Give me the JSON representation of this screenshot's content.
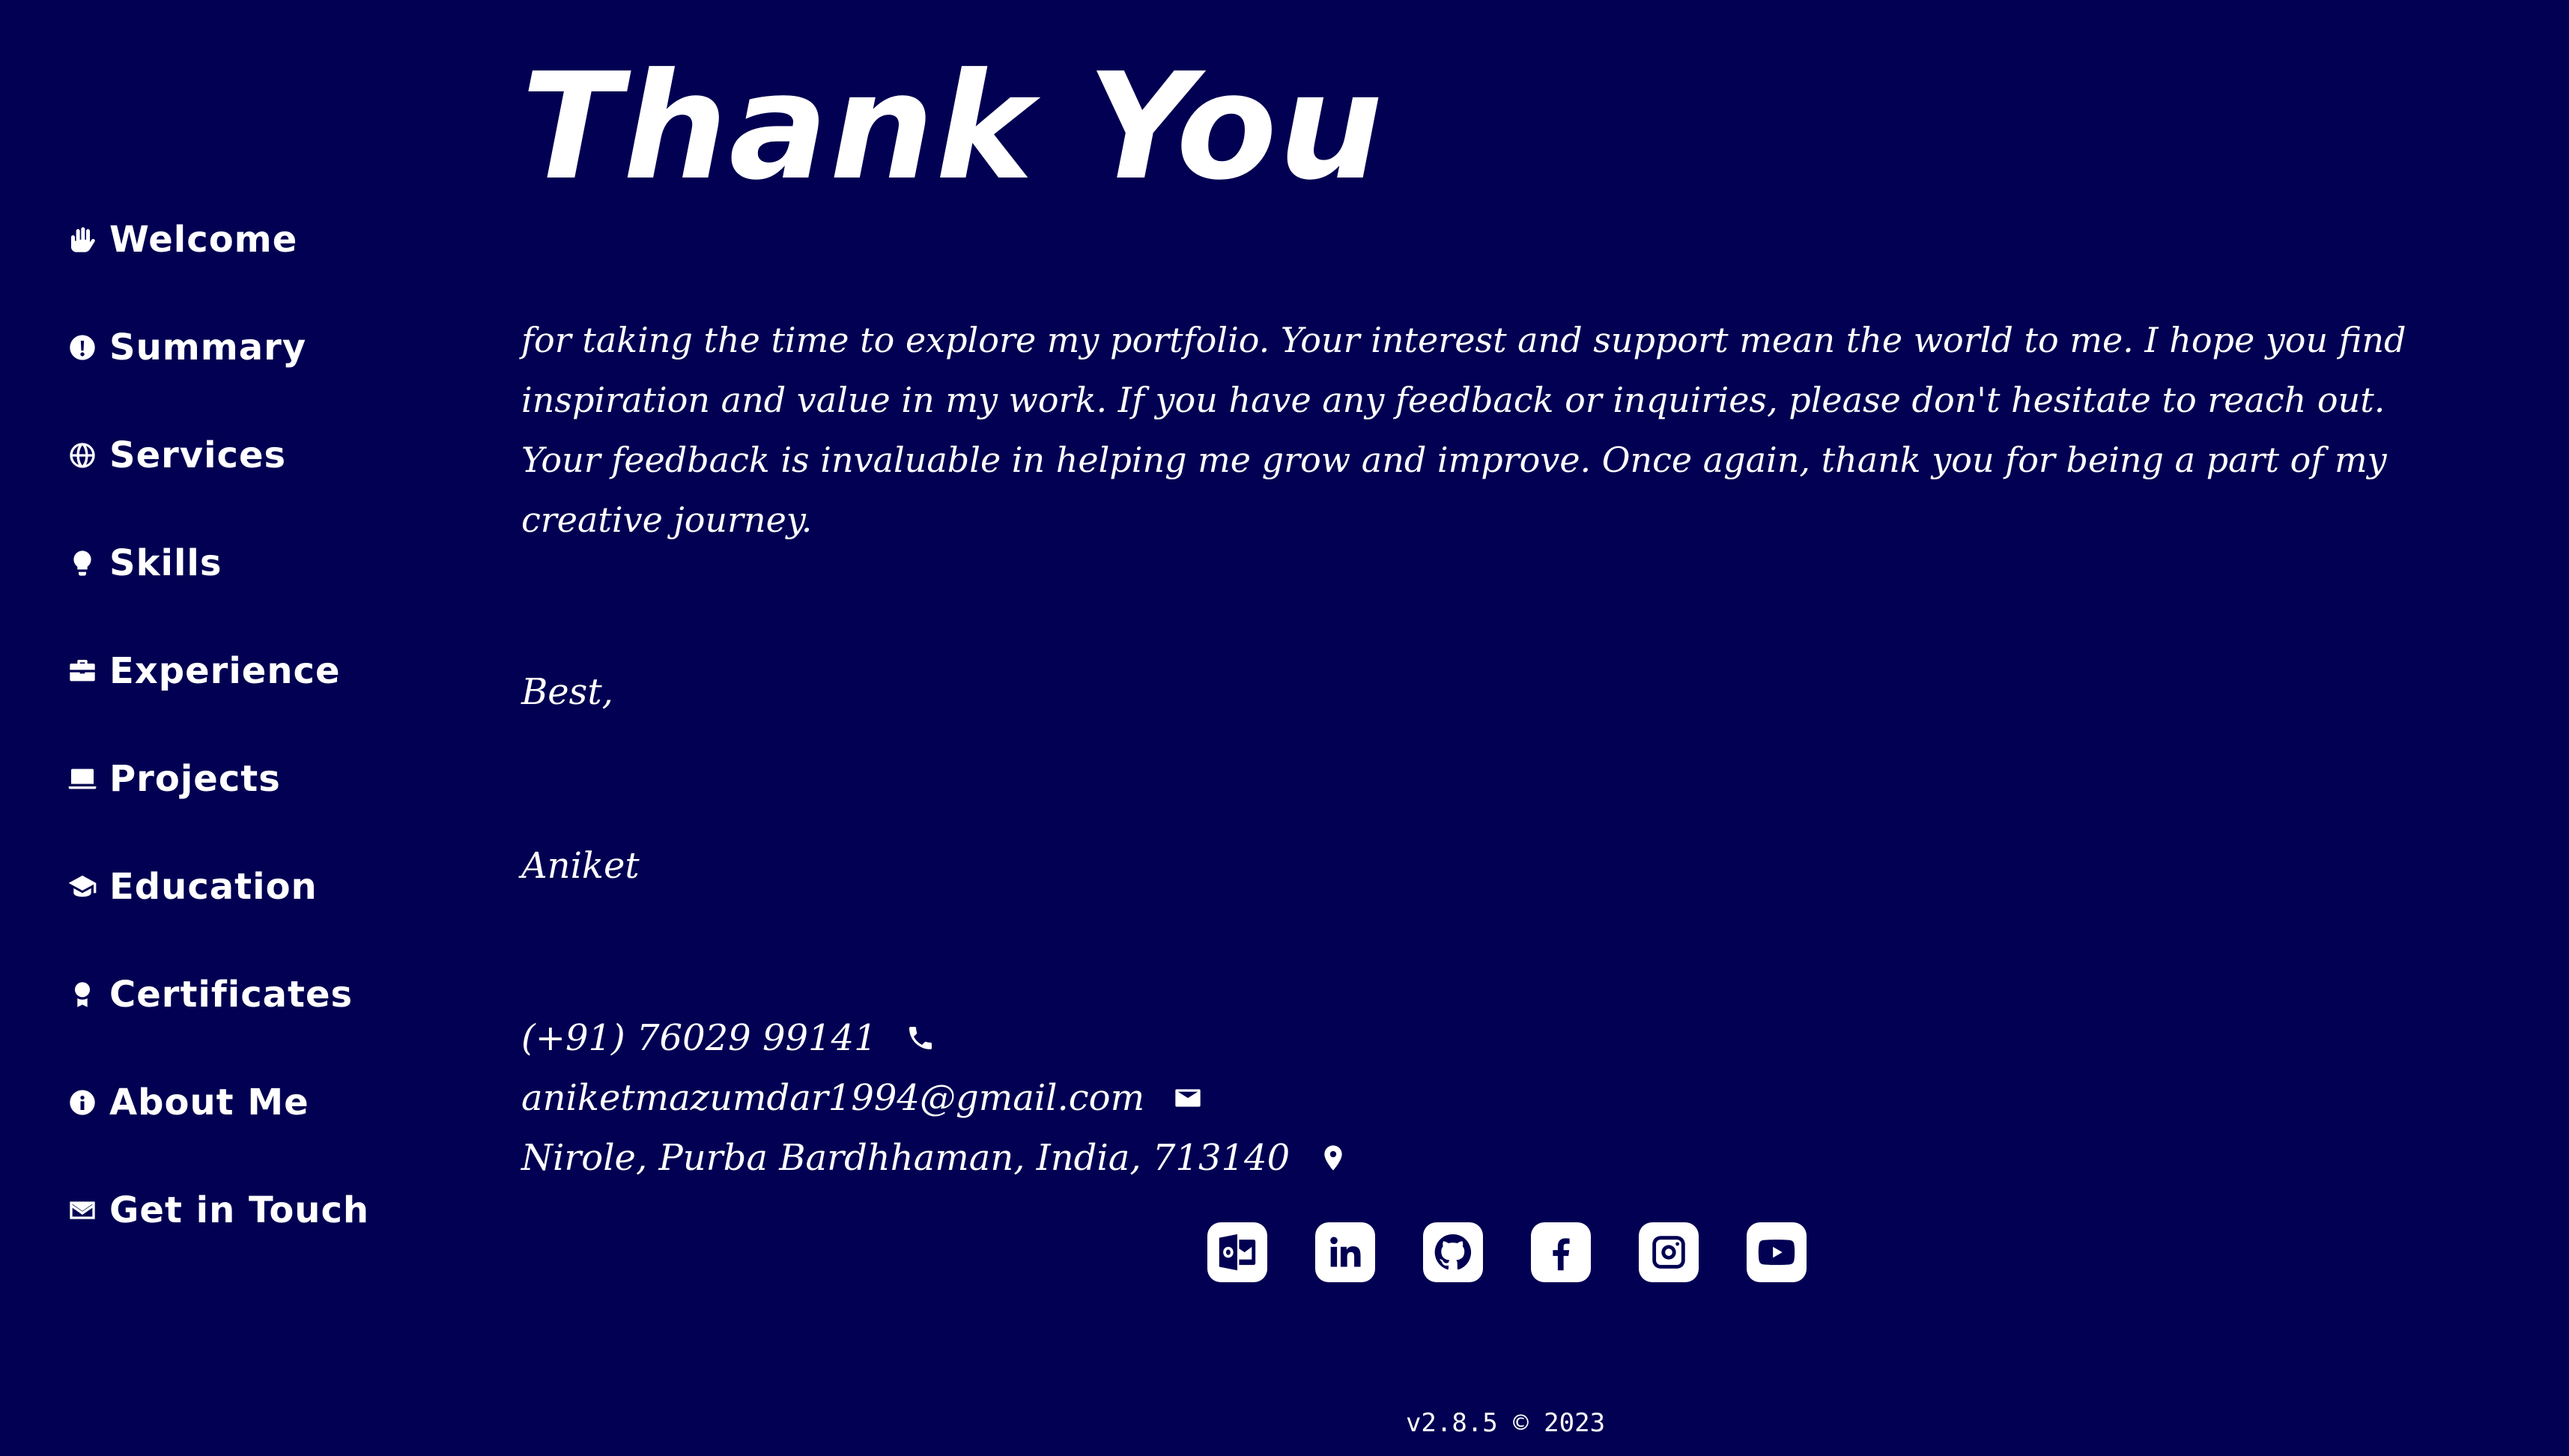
{
  "sidebar": {
    "items": [
      {
        "label": "Welcome",
        "icon": "waving-hand-icon"
      },
      {
        "label": "Summary",
        "icon": "exclamation-circle-icon"
      },
      {
        "label": "Services",
        "icon": "globe-icon"
      },
      {
        "label": "Skills",
        "icon": "lightbulb-icon"
      },
      {
        "label": "Experience",
        "icon": "briefcase-icon"
      },
      {
        "label": "Projects",
        "icon": "laptop-icon"
      },
      {
        "label": "Education",
        "icon": "graduation-cap-icon"
      },
      {
        "label": "Certificates",
        "icon": "award-icon"
      },
      {
        "label": "About Me",
        "icon": "info-circle-icon"
      },
      {
        "label": "Get in Touch",
        "icon": "envelope-icon"
      }
    ]
  },
  "main": {
    "title": "Thank You",
    "message": "for taking the time to explore my portfolio. Your interest and support mean the world to me. I hope you find inspiration and value in my work. If you have any feedback or inquiries, please don't hesitate to reach out. Your feedback is invaluable in helping me grow and improve. Once again, thank you for being a part of my creative journey.",
    "signoff": "Best,",
    "signature": "Aniket",
    "contact": {
      "phone": "(+91) 76029 99141",
      "email": "aniketmazumdar1994@gmail.com",
      "address": "Nirole, Purba Bardhhaman, India, 713140"
    }
  },
  "social": [
    {
      "icon": "outlook-icon"
    },
    {
      "icon": "linkedin-icon"
    },
    {
      "icon": "github-icon"
    },
    {
      "icon": "facebook-icon"
    },
    {
      "icon": "instagram-icon"
    },
    {
      "icon": "youtube-icon"
    }
  ],
  "footer": {
    "text": "v2.8.5 © 2023"
  },
  "colors": {
    "background": "#010052",
    "text": "#ffffff"
  }
}
